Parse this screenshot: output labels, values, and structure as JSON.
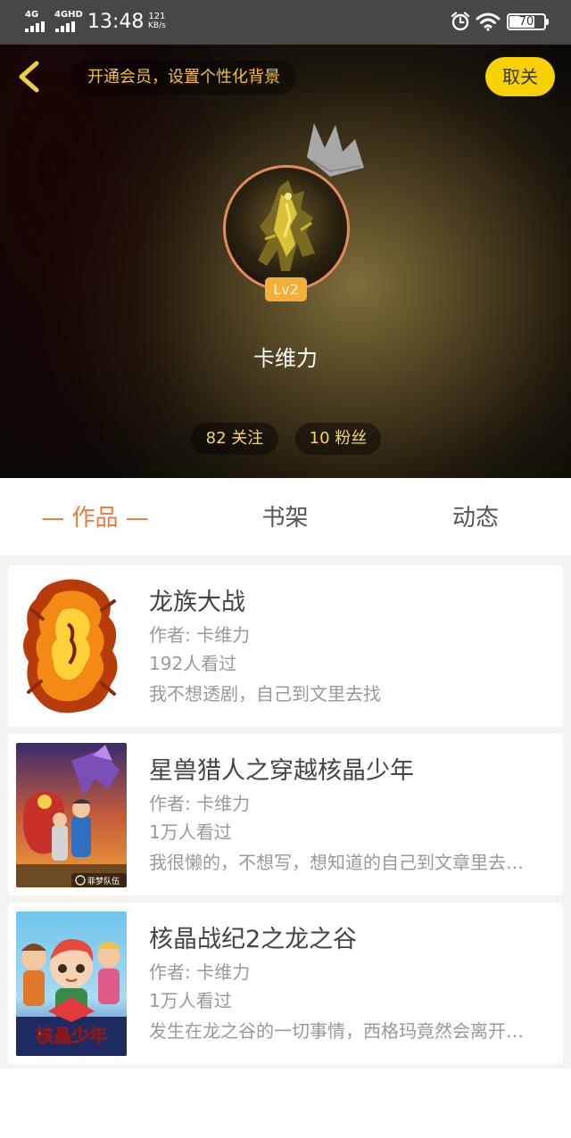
{
  "status_bar": {
    "sim1": "4G",
    "sim2": "4GHD",
    "time": "13:48",
    "net_speed_value": "121",
    "net_speed_unit": "KB/s",
    "battery": "70",
    "icons": [
      "alarm-icon",
      "wifi-icon",
      "battery-icon"
    ]
  },
  "header": {
    "promo_text": "开通会员，设置个性化背景",
    "cancel_follow_label": "取关",
    "level": "Lv2",
    "username": "卡维力",
    "following": "82 关注",
    "followers": "10 粉丝",
    "accent_color": "#f7d100"
  },
  "tabs": [
    {
      "label": "— 作品 —",
      "active": true
    },
    {
      "label": "书架",
      "active": false
    },
    {
      "label": "动态",
      "active": false
    }
  ],
  "works": [
    {
      "title": "龙族大战",
      "author": "作者: 卡维力",
      "views": "192人看过",
      "description": "我不想透剧，自己到文里去找"
    },
    {
      "title": "星兽猎人之穿越核晶少年",
      "author": "作者: 卡维力",
      "views": "1万人看过",
      "description": "我很懒的，不想写，想知道的自己到文章里去看吧",
      "cover_caption": "菲梦队伍"
    },
    {
      "title": "核晶战纪2之龙之谷",
      "author": "作者: 卡维力",
      "views": "1万人看过",
      "description": "发生在龙之谷的一切事情，西格玛竟然会离开大家",
      "cover_caption": "核晶少年"
    }
  ],
  "colors": {
    "tab_active": "#f07a3e",
    "level_badge": "#f4ae3a",
    "avatar_ring": "#e58a5b"
  }
}
